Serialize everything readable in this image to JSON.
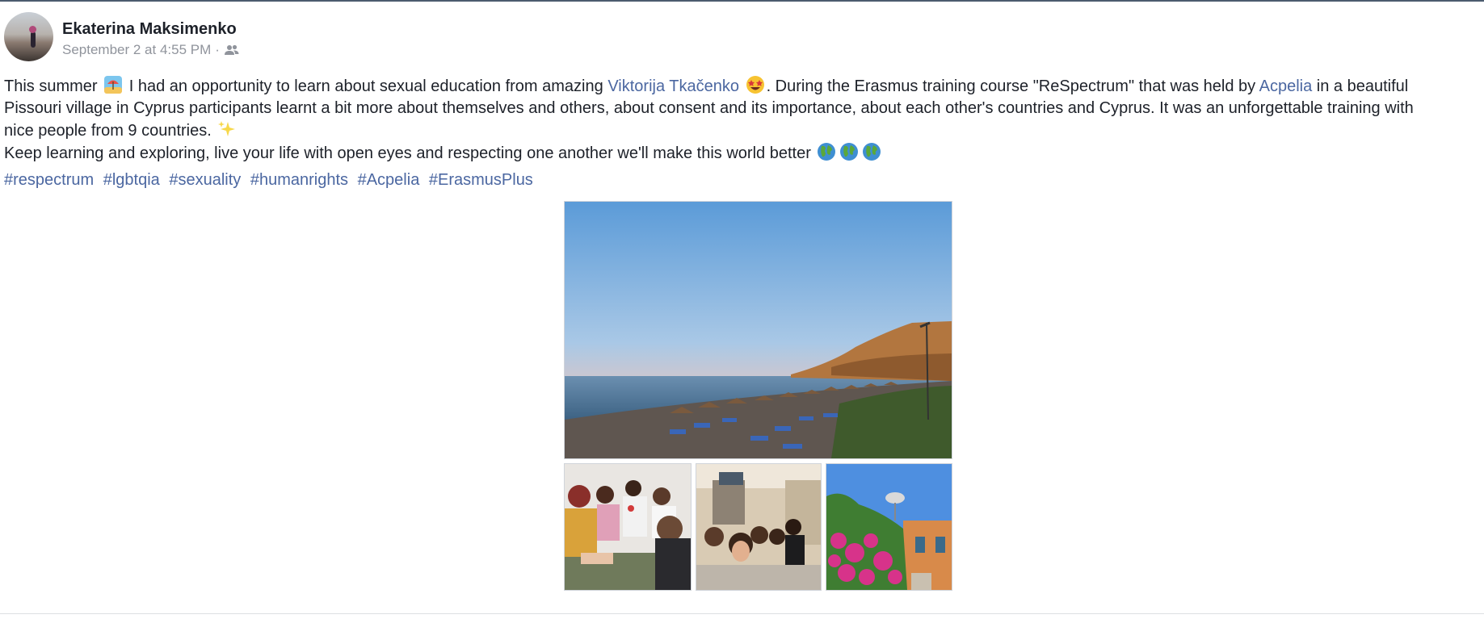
{
  "post": {
    "author": "Ekaterina Maksimenko",
    "timestamp": "September 2 at 4:55 PM",
    "separator": "·",
    "audience_icon": "friends-icon",
    "text": {
      "l1_a": "This summer",
      "l1_b": "I had an opportunity to learn about sexual education from amazing",
      "mention_person": "Viktorija Tkačenko",
      "l1_c": ". During the Erasmus training course \"ReSpectrum\" that was held by",
      "mention_org": "Acpelia",
      "l1_d": "in a beautiful",
      "l2": "Pissouri village in Cyprus participants learnt a bit more about themselves and others, about consent and its importance, about each other's countries and Cyprus. It was an unforgettable training with",
      "l3": "nice people from 9 countries.",
      "l4": "Keep learning and exploring, live your life with open eyes and respecting one another we'll make this world better"
    },
    "emojis": [
      "beach-umbrella-emoji",
      "star-struck-emoji",
      "sparkles-emoji",
      "globe-emoji",
      "globe-emoji",
      "globe-emoji"
    ],
    "hashtags": [
      "#respectrum",
      "#lgbtqia",
      "#sexuality",
      "#humanrights",
      "#Acpelia",
      "#ErasmusPlus"
    ],
    "photos": [
      "beach-sunset-photo",
      "group-discussion-photo",
      "group-selfie-photo",
      "bougainvillea-street-photo"
    ]
  },
  "colors": {
    "link": "#4b67a1",
    "text": "#1d2129",
    "meta": "#90949c"
  }
}
